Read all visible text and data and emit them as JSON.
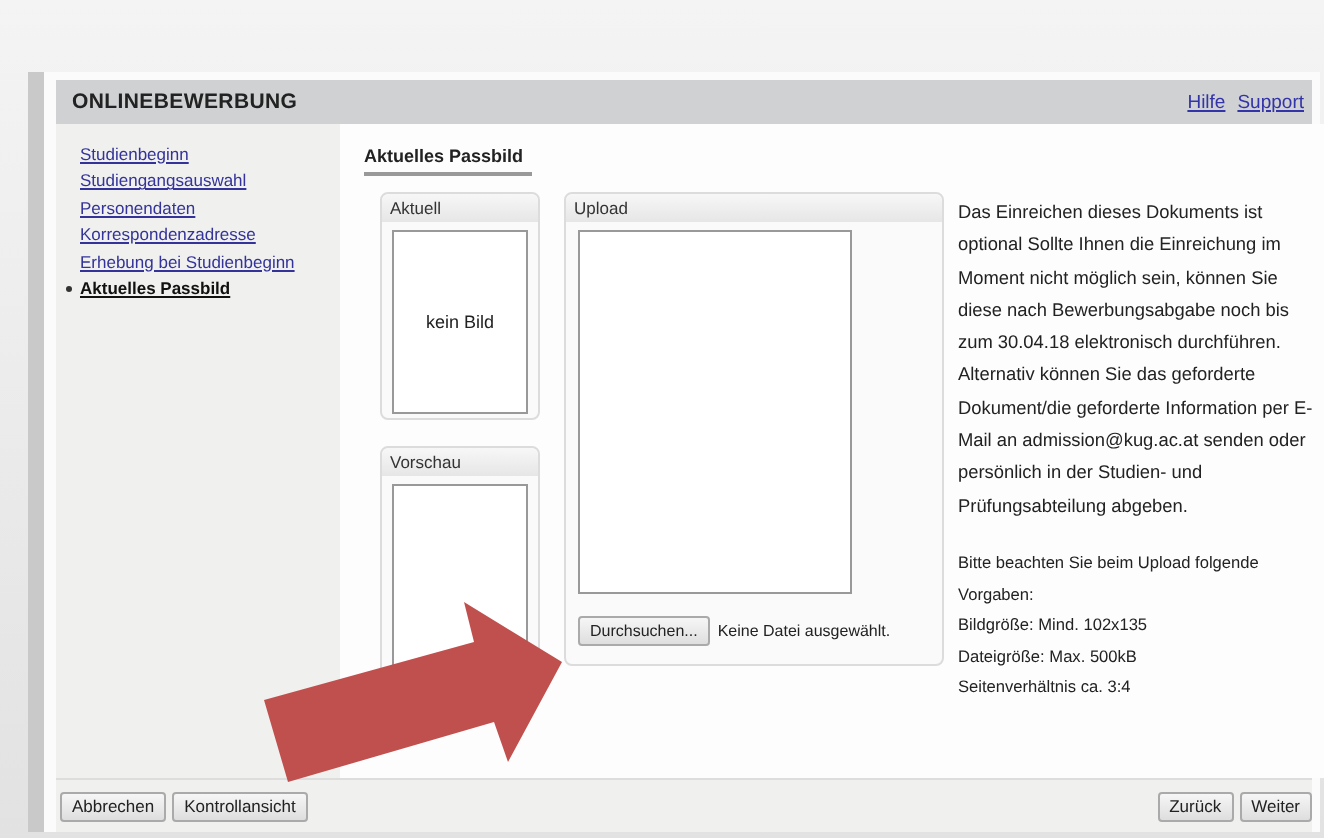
{
  "header": {
    "title": "ONLINEBEWERBUNG",
    "links": [
      "Hilfe",
      "Support"
    ]
  },
  "sidebar": {
    "items": [
      {
        "label": "Studienbeginn",
        "selected": false
      },
      {
        "label": "Studiengangsauswahl",
        "selected": false
      },
      {
        "label": "Personendaten",
        "selected": false
      },
      {
        "label": "Korrespondenzadresse",
        "selected": false
      },
      {
        "label": "Erhebung bei Studienbeginn",
        "selected": false
      },
      {
        "label": "Aktuelles Passbild",
        "selected": true
      }
    ]
  },
  "tab": {
    "label": "Aktuelles Passbild"
  },
  "current": {
    "title": "Aktuell",
    "empty_text": "kein Bild"
  },
  "preview": {
    "title": "Vorschau"
  },
  "upload": {
    "title": "Upload",
    "browse_button": "Durchsuchen...",
    "file_status": "Keine Datei ausgewählt."
  },
  "info": {
    "paragraph": "Das Einreichen dieses Dokuments ist optional Sollte Ihnen die Einreichung im Moment nicht möglich sein, können Sie diese nach Bewerbungsabgabe noch bis zum 30.04.18 elektronisch durchführen. Alternativ können Sie das geforderte Dokument/die geforderte Information per E-Mail an admission@kug.ac.at senden oder persönlich in der Studien- und Prüfungsabteilung abgeben.",
    "requirements": [
      "Bitte beachten Sie beim Upload folgende Vorgaben:",
      "Bildgröße: Mind. 102x135",
      "Dateigröße: Max. 500kB",
      "Seitenverhältnis ca. 3:4"
    ]
  },
  "footer": {
    "left_buttons": [
      "Abbrechen",
      "Kontrollansicht"
    ],
    "right_buttons": [
      "Zurück",
      "Weiter"
    ]
  }
}
